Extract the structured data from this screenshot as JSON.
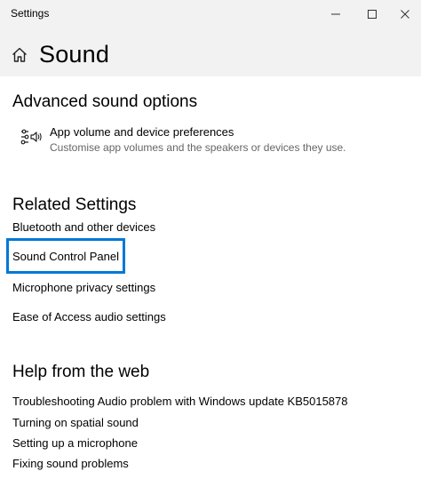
{
  "window": {
    "title": "Settings",
    "minimize_glyph": "—",
    "maximize_glyph": "☐",
    "close_glyph": "✕"
  },
  "header": {
    "icon": "home-icon",
    "title": "Sound"
  },
  "advanced": {
    "heading": "Advanced sound options",
    "item": {
      "icon": "mixer-icon",
      "title": "App volume and device preferences",
      "subtitle": "Customise app volumes and the speakers or devices they use."
    }
  },
  "related": {
    "heading": "Related Settings",
    "links": [
      "Bluetooth and other devices",
      "Sound Control Panel",
      "Microphone privacy settings",
      "Ease of Access audio settings"
    ],
    "focused_index": 1,
    "focus_color": "#0078d7"
  },
  "help": {
    "heading": "Help from the web",
    "links": [
      "Troubleshooting Audio problem with Windows update KB5015878",
      "Turning on spatial sound",
      "Setting up a microphone",
      "Fixing sound problems"
    ]
  }
}
